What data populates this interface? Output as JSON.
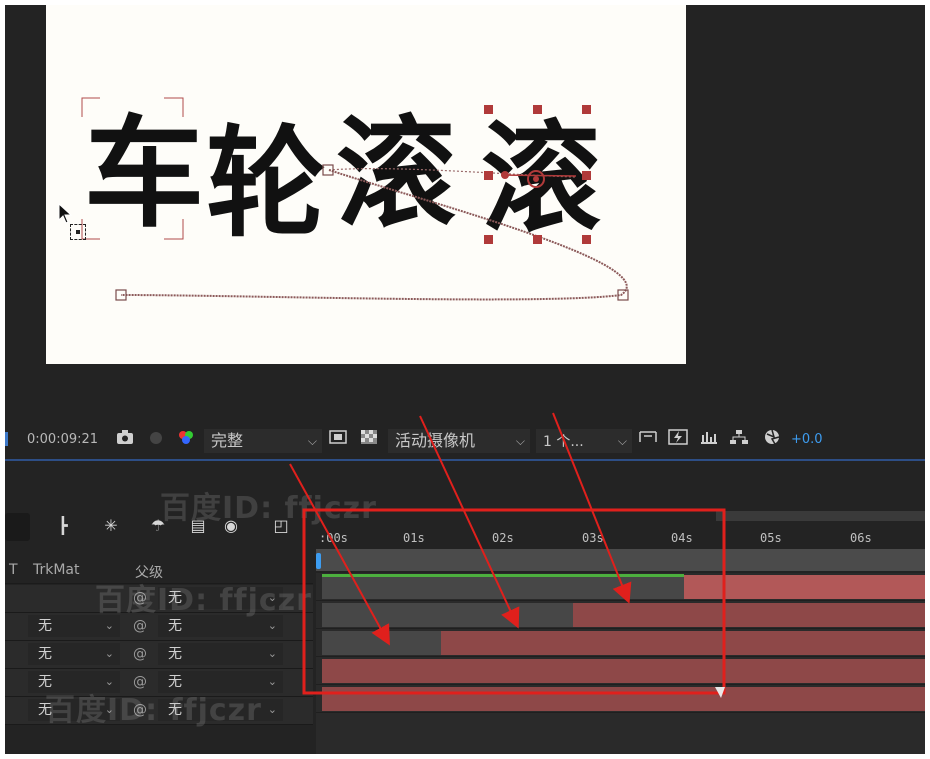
{
  "composition": {
    "title_chars": [
      "车",
      "轮",
      "滚",
      "滚"
    ]
  },
  "viewer_toolbar": {
    "timecode": "0:00:09:21",
    "camera_icon": "camera-icon",
    "resolution": "完整",
    "camera_view": "活动摄像机",
    "views": "1 个...",
    "exposure": "+0.0"
  },
  "timeline": {
    "columns": {
      "t": "T",
      "trkmat": "TrkMat",
      "parent": "父级"
    },
    "ruler_labels": [
      ":00s",
      "01s",
      "02s",
      "03s",
      "04s",
      "05s",
      "06s"
    ],
    "layers": [
      {
        "trkmat": "",
        "parent": "无"
      },
      {
        "trkmat": "无",
        "parent": "无"
      },
      {
        "trkmat": "无",
        "parent": "无"
      },
      {
        "trkmat": "无",
        "parent": "无"
      },
      {
        "trkmat": "无",
        "parent": "无"
      }
    ]
  },
  "watermark": "百度ID: ffjczr",
  "colors": {
    "accent_blue": "#3d9cf0",
    "layer_bar": "#8e4848",
    "annotation_red": "#e0201c",
    "work_area_green": "#4caf3e"
  }
}
